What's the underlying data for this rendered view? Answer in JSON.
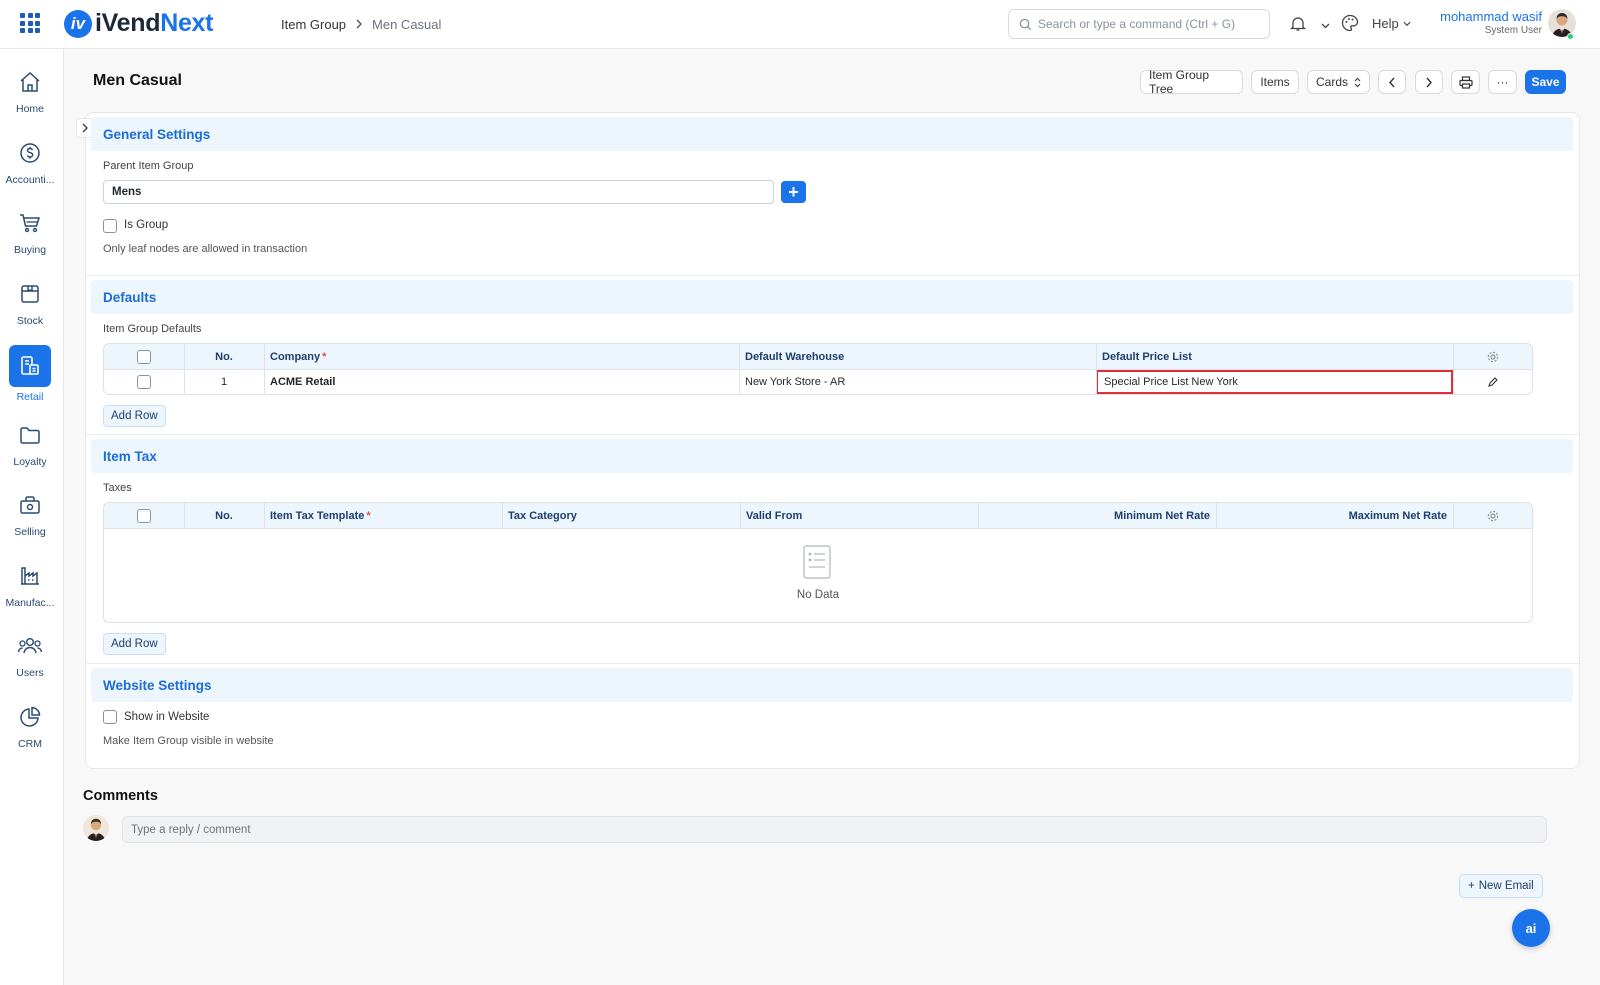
{
  "app": {
    "name_a": "iVend",
    "name_b": "Next",
    "logo_mark": "iv"
  },
  "breadcrumb": {
    "parent": "Item Group",
    "current": "Men Casual"
  },
  "search": {
    "placeholder": "Search or type a command (Ctrl + G)"
  },
  "header": {
    "help_label": "Help",
    "user_name": "mohammad wasif",
    "user_role": "System User"
  },
  "sidebar": {
    "items": [
      {
        "label": "Home",
        "icon": "home-icon"
      },
      {
        "label": "Accounti...",
        "icon": "dollar-icon"
      },
      {
        "label": "Buying",
        "icon": "cart-icon"
      },
      {
        "label": "Stock",
        "icon": "box-icon"
      },
      {
        "label": "Retail",
        "icon": "retail-icon",
        "active": true
      },
      {
        "label": "Loyalty",
        "icon": "folder-icon"
      },
      {
        "label": "Selling",
        "icon": "bag-icon"
      },
      {
        "label": "Manufac...",
        "icon": "factory-icon"
      },
      {
        "label": "Users",
        "icon": "users-icon"
      },
      {
        "label": "CRM",
        "icon": "pie-icon"
      }
    ]
  },
  "page": {
    "title": "Men Casual"
  },
  "toolbar": {
    "item_group_tree": "Item Group Tree",
    "items": "Items",
    "cards": "Cards",
    "more": "···",
    "save": "Save"
  },
  "general": {
    "title": "General Settings",
    "parent_label": "Parent Item Group",
    "parent_value": "Mens",
    "is_group_label": "Is Group",
    "hint": "Only leaf nodes are allowed in transaction"
  },
  "defaults": {
    "title": "Defaults",
    "table_label": "Item Group Defaults",
    "headers": {
      "no": "No.",
      "company": "Company",
      "warehouse": "Default Warehouse",
      "price_list": "Default Price List"
    },
    "rows": [
      {
        "no": "1",
        "company": "ACME Retail",
        "warehouse": "New York Store - AR",
        "price_list": "Special Price List New York"
      }
    ],
    "add_row": "Add Row"
  },
  "item_tax": {
    "title": "Item Tax",
    "table_label": "Taxes",
    "headers": {
      "no": "No.",
      "template": "Item Tax Template",
      "category": "Tax Category",
      "valid_from": "Valid From",
      "min_rate": "Minimum Net Rate",
      "max_rate": "Maximum Net Rate"
    },
    "empty": "No Data",
    "add_row": "Add Row"
  },
  "website": {
    "title": "Website Settings",
    "show_label": "Show in Website",
    "hint": "Make Item Group visible in website"
  },
  "comments": {
    "title": "Comments",
    "placeholder": "Type a reply / comment",
    "new_email": "New Email"
  },
  "assistant": {
    "label": "ai"
  },
  "colors": {
    "accent": "#1a73e8",
    "section_bg": "#edf5fd",
    "highlight": "#d9303a"
  }
}
